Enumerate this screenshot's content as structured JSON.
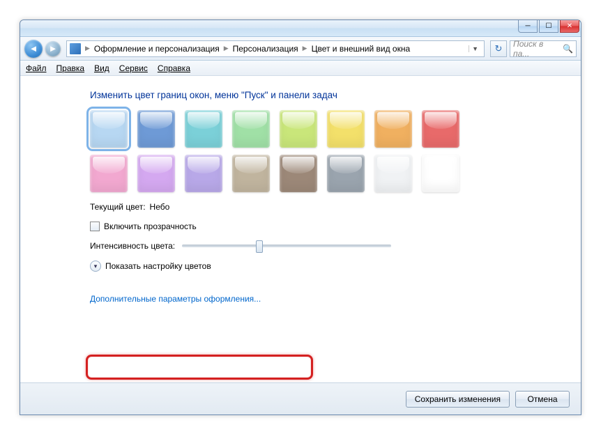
{
  "window": {
    "breadcrumb": [
      "Оформление и персонализация",
      "Персонализация",
      "Цвет и внешний вид окна"
    ],
    "search_placeholder": "Поиск в па..."
  },
  "menubar": [
    "Файл",
    "Правка",
    "Вид",
    "Сервис",
    "Справка"
  ],
  "heading": "Изменить цвет границ окон, меню \"Пуск\" и панели задач",
  "swatches": {
    "row1": [
      {
        "name": "sky",
        "color": "#b7d7f2",
        "selected": true
      },
      {
        "name": "twilight",
        "color": "#6e9ad6"
      },
      {
        "name": "sea",
        "color": "#7bd0d8"
      },
      {
        "name": "leaf",
        "color": "#a0e0a6"
      },
      {
        "name": "lime",
        "color": "#c9e67a"
      },
      {
        "name": "sun",
        "color": "#f3e06a"
      },
      {
        "name": "pumpkin",
        "color": "#f0b060"
      },
      {
        "name": "ruby",
        "color": "#e86a6a"
      }
    ],
    "row2": [
      {
        "name": "fuchsia",
        "color": "#f2a8d0"
      },
      {
        "name": "violet",
        "color": "#d4a8f0"
      },
      {
        "name": "lavender",
        "color": "#b8a8e8"
      },
      {
        "name": "taupe",
        "color": "#c0b49e"
      },
      {
        "name": "chocolate",
        "color": "#9c8878"
      },
      {
        "name": "slate",
        "color": "#9aa4ae"
      },
      {
        "name": "frost",
        "color": "#f0f2f4"
      },
      {
        "name": "blank",
        "color": "#ffffff"
      }
    ]
  },
  "current_color": {
    "label": "Текущий цвет:",
    "value": "Небо"
  },
  "transparency": {
    "label": "Включить прозрачность"
  },
  "intensity": {
    "label": "Интенсивность цвета:",
    "value_pct": 37
  },
  "show_mixer": {
    "label": "Показать настройку цветов"
  },
  "advanced_link": "Дополнительные параметры оформления...",
  "footer": {
    "save": "Сохранить изменения",
    "cancel": "Отмена"
  }
}
